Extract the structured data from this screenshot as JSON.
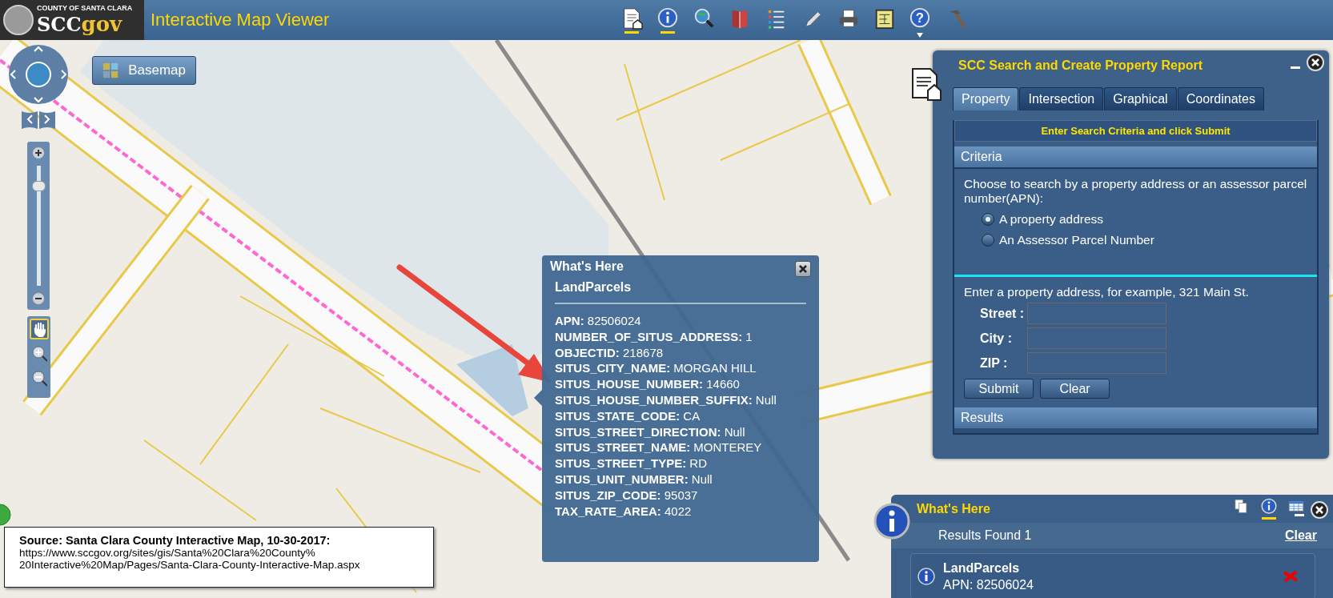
{
  "header": {
    "logo_top": "COUNTY OF SANTA CLARA",
    "logo_left": "SCC",
    "logo_right": "gov",
    "title": "Interactive Map Viewer",
    "tools": [
      {
        "kind": "report",
        "active": true
      },
      {
        "kind": "info",
        "active": true
      },
      {
        "kind": "search",
        "active": false
      },
      {
        "kind": "book",
        "active": false
      },
      {
        "kind": "list",
        "active": false
      },
      {
        "kind": "pencil",
        "active": false
      },
      {
        "kind": "print",
        "active": false
      },
      {
        "kind": "measure",
        "active": false
      },
      {
        "kind": "help",
        "active": false,
        "menu": true,
        "symbol": "?"
      },
      {
        "kind": "hammer",
        "active": false
      }
    ]
  },
  "basemap_button": {
    "label": "Basemap"
  },
  "zoom_slider": {
    "level": 0.86
  },
  "map_tools": [
    {
      "kind": "pan",
      "selected": true
    },
    {
      "kind": "zoom_in",
      "selected": false
    },
    {
      "kind": "zoom_out",
      "selected": false
    }
  ],
  "popup": {
    "title": "What's Here",
    "layer": "LandParcels",
    "attributes": [
      {
        "label": "APN:",
        "value": "82506024"
      },
      {
        "label": "NUMBER_OF_SITUS_ADDRESS:",
        "value": "1"
      },
      {
        "label": "OBJECTID:",
        "value": "218678"
      },
      {
        "label": "SITUS_CITY_NAME:",
        "value": "MORGAN HILL"
      },
      {
        "label": "SITUS_HOUSE_NUMBER:",
        "value": "14660"
      },
      {
        "label": "SITUS_HOUSE_NUMBER_SUFFIX:",
        "value": "Null"
      },
      {
        "label": "SITUS_STATE_CODE:",
        "value": "CA"
      },
      {
        "label": "SITUS_STREET_DIRECTION:",
        "value": "Null"
      },
      {
        "label": "SITUS_STREET_NAME:",
        "value": "MONTEREY"
      },
      {
        "label": "SITUS_STREET_TYPE:",
        "value": "RD"
      },
      {
        "label": "SITUS_UNIT_NUMBER:",
        "value": "Null"
      },
      {
        "label": "SITUS_ZIP_CODE:",
        "value": "95037"
      },
      {
        "label": "TAX_RATE_AREA:",
        "value": "4022"
      }
    ]
  },
  "search_panel": {
    "title": "SCC Search and Create Property Report",
    "tabs": [
      {
        "label": "Property",
        "selected": true
      },
      {
        "label": "Intersection",
        "selected": false
      },
      {
        "label": "Graphical",
        "selected": false
      },
      {
        "label": "Coordinates",
        "selected": false
      }
    ],
    "instruction": "Enter Search Criteria and click Submit",
    "criteria_header": "Criteria",
    "description": "Choose to search by a property address or an assessor parcel number(APN):",
    "options": [
      {
        "label": "A property address",
        "selected": true
      },
      {
        "label": "An Assessor Parcel Number",
        "selected": false
      }
    ],
    "hint": "Enter a property address, for example, 321 Main St.",
    "fields": [
      {
        "label": "Street :"
      },
      {
        "label": "City :"
      },
      {
        "label": "ZIP :"
      }
    ],
    "buttons": [
      "Submit",
      "Clear"
    ],
    "results_header": "Results"
  },
  "whats_here_panel": {
    "title": "What's Here",
    "views": [
      {
        "kind": "copy",
        "active": false
      },
      {
        "kind": "info",
        "active": true
      },
      {
        "kind": "table",
        "active": false
      }
    ],
    "results_count": "Results Found 1",
    "clear_link": "Clear",
    "results": [
      {
        "title": "LandParcels",
        "detail": "APN: 82506024"
      }
    ]
  },
  "source_note": {
    "heading": "Source: Santa Clara County Interactive Map, 10-30-2017:",
    "url_lines": [
      "https://www.sccgov.org/sites/gis/Santa%20Clara%20County%",
      "20Interactive%20Map/Pages/Santa-Clara-County-Interactive-Map.aspx"
    ]
  }
}
